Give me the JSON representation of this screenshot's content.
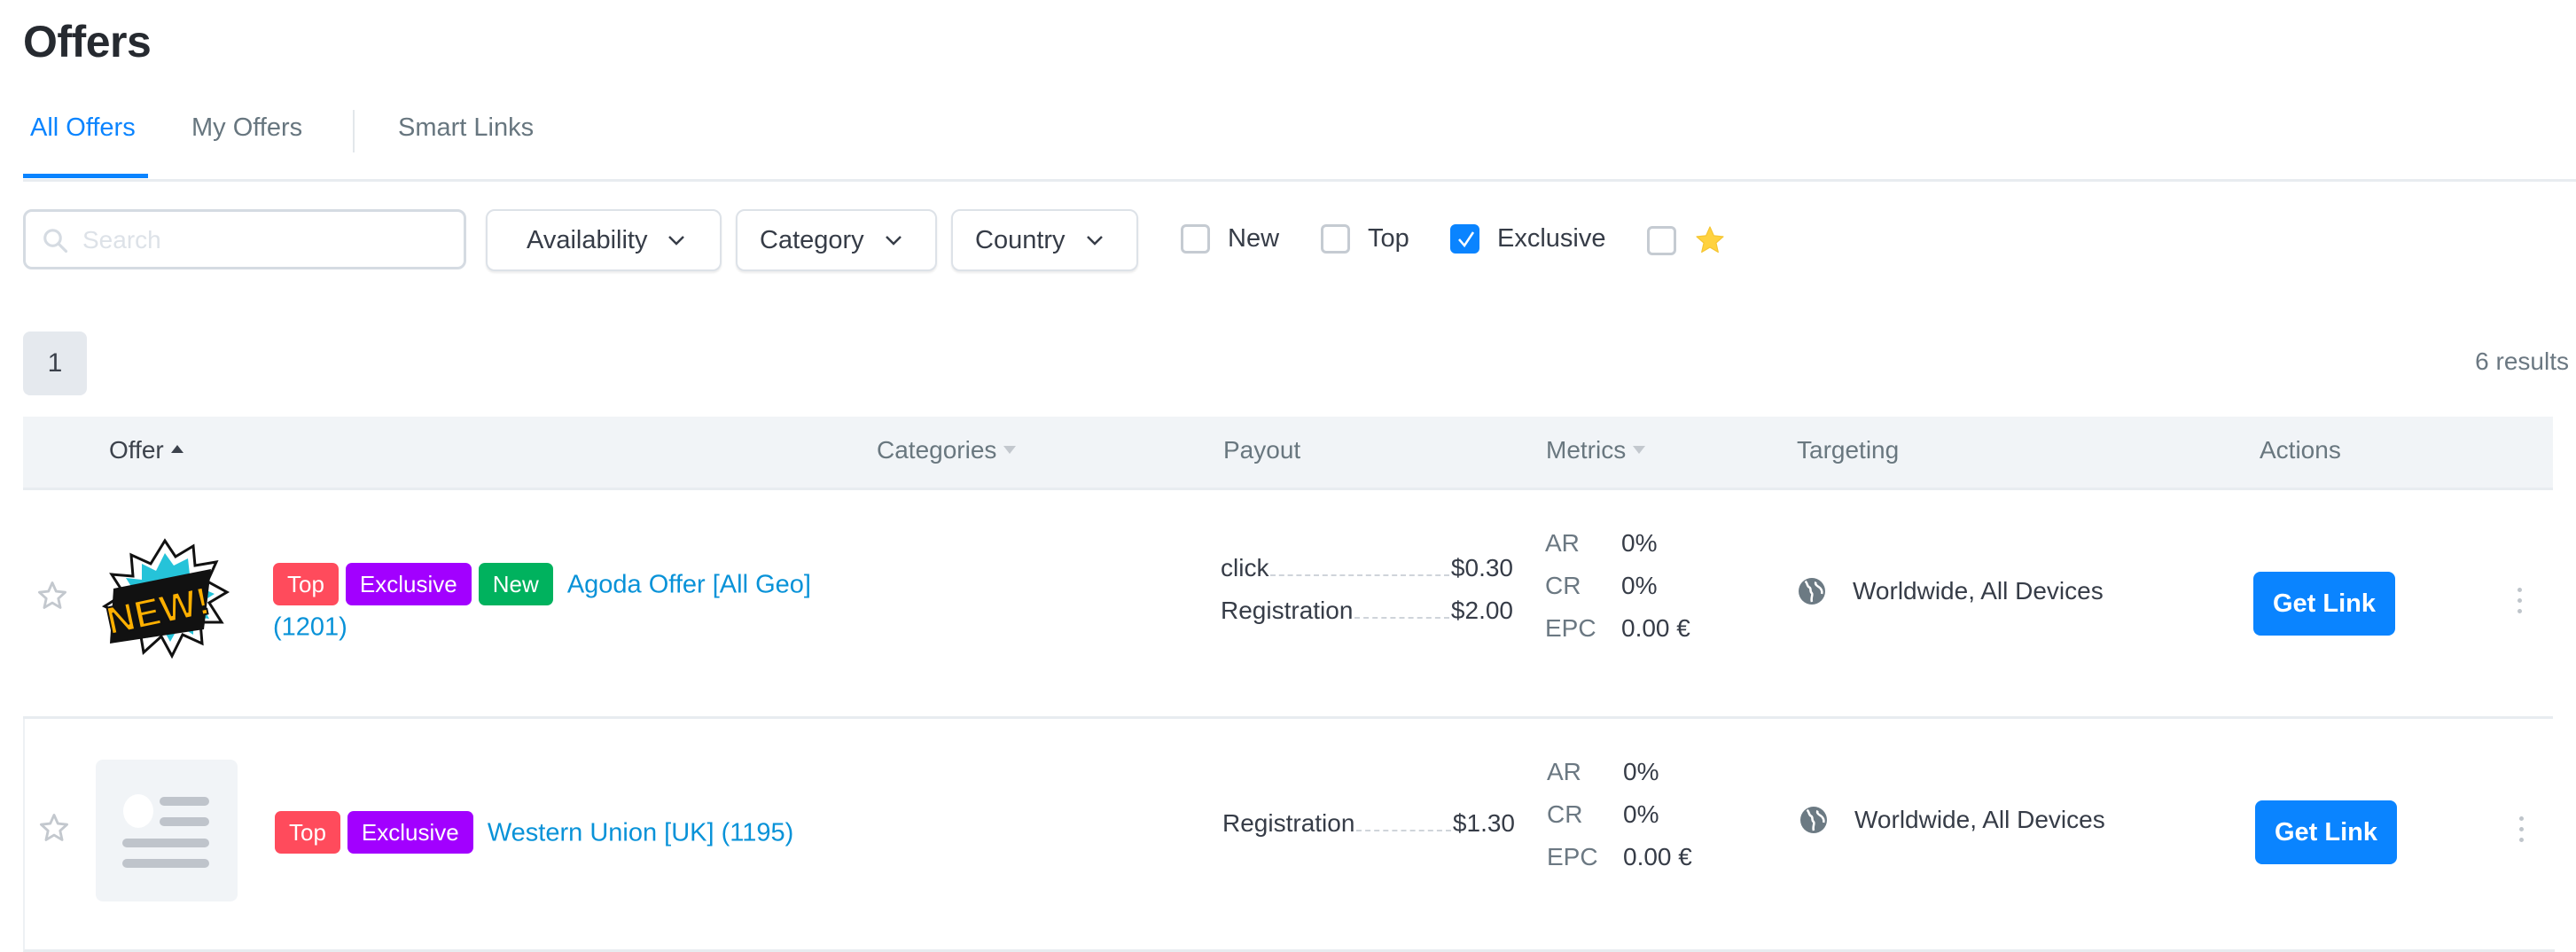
{
  "page": {
    "title": "Offers"
  },
  "tabs": [
    {
      "label": "All Offers",
      "active": true
    },
    {
      "label": "My Offers",
      "active": false
    },
    {
      "label": "Smart Links",
      "active": false
    }
  ],
  "filters": {
    "search": {
      "placeholder": "Search",
      "value": ""
    },
    "dropdowns": [
      {
        "label": "Availability"
      },
      {
        "label": "Category"
      },
      {
        "label": "Country"
      }
    ],
    "checkboxes": [
      {
        "label": "New",
        "checked": false
      },
      {
        "label": "Top",
        "checked": false
      },
      {
        "label": "Exclusive",
        "checked": true
      },
      {
        "label": "",
        "icon": "star-icon",
        "checked": false
      }
    ]
  },
  "pagination": {
    "current_page": "1",
    "results_text": "6 results"
  },
  "table": {
    "headers": {
      "offer": "Offer",
      "categories": "Categories",
      "payout": "Payout",
      "metrics": "Metrics",
      "targeting": "Targeting",
      "actions": "Actions"
    },
    "rows": [
      {
        "thumbnail": "new-comic-burst-image",
        "badges": [
          "Top",
          "Exclusive",
          "New"
        ],
        "name": "Agoda Offer [All Geo] (1201)",
        "categories": "",
        "payouts": [
          {
            "type": "click",
            "amount": "$0.30"
          },
          {
            "type": "Registration",
            "amount": "$2.00"
          }
        ],
        "metrics": {
          "AR": "0%",
          "CR": "0%",
          "EPC": "0.00 €"
        },
        "targeting": "Worldwide, All Devices",
        "action_label": "Get Link"
      },
      {
        "thumbnail": "placeholder-image",
        "badges": [
          "Top",
          "Exclusive"
        ],
        "name": "Western Union [UK] (1195)",
        "categories": "",
        "payouts": [
          {
            "type": "Registration",
            "amount": "$1.30"
          }
        ],
        "metrics": {
          "AR": "0%",
          "CR": "0%",
          "EPC": "0.00 €"
        },
        "targeting": "Worldwide, All Devices",
        "action_label": "Get Link"
      }
    ]
  },
  "metric_labels": {
    "ar": "AR",
    "cr": "CR",
    "epc": "EPC"
  },
  "colors": {
    "accent": "#0a84ff",
    "badge_top": "#ff4b5c",
    "badge_exclusive": "#a200ff",
    "badge_new": "#00b25e",
    "link": "#0892d8",
    "star": "#ffd23f"
  }
}
